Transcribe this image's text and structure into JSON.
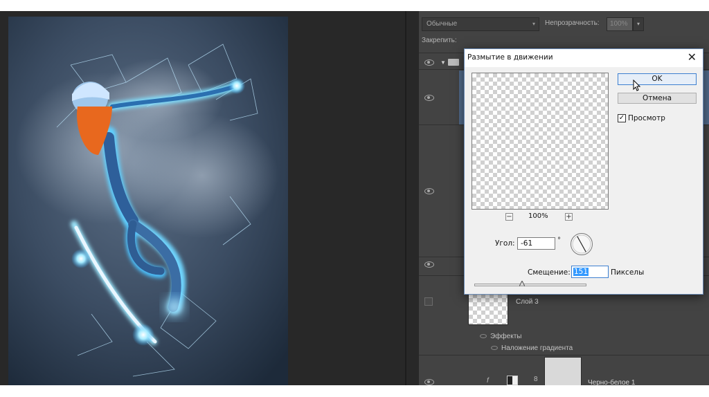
{
  "layers_panel": {
    "blend_mode": "Обычные",
    "opacity_label": "Непрозрачность:",
    "opacity_value": "100%",
    "lock_label": "Закрепить:",
    "layer3_name": "Слой 3",
    "effects_label": "Эффекты",
    "gradient_overlay_label": "Наложение градиента",
    "bw_layer_fx": "f",
    "bw_layer_name": "Черно-белое 1"
  },
  "dialog": {
    "title": "Размытие в движении",
    "close_symbol": "✕",
    "ok_label": "OK",
    "cancel_label": "Отмена",
    "preview_label": "Просмотр",
    "preview_checked": true,
    "zoom_minus": "−",
    "zoom_plus": "+",
    "zoom_value": "100%",
    "angle_label": "Угол:",
    "angle_value": "-61",
    "degree_symbol": "°",
    "offset_label": "Смещение:",
    "offset_value": "151",
    "offset_unit": "Пикселы",
    "offset_slider_fraction": 0.42
  },
  "icons": {
    "dropdown": "▾",
    "group_arrow": "▼",
    "chain": "8"
  },
  "colors": {
    "workspace_bg": "#282828",
    "panel_bg": "#434343",
    "selected_layer": "#516a8a",
    "dialog_bg": "#f0f0f0",
    "accent_blue": "#3c7fd0"
  }
}
